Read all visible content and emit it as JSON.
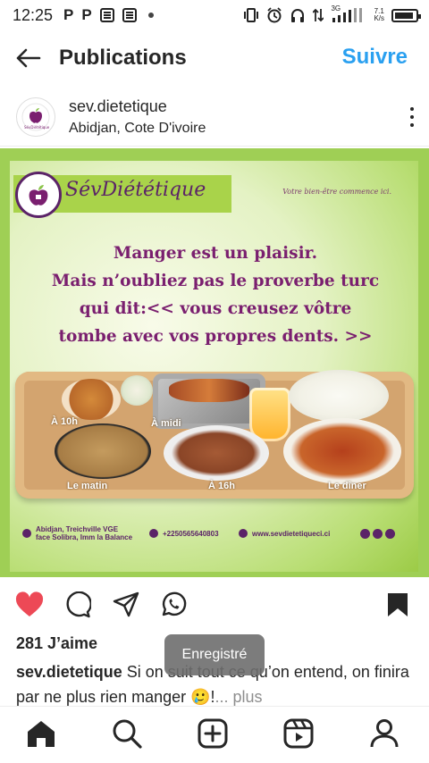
{
  "status_bar": {
    "time": "12:25",
    "left_icons": [
      "P",
      "P"
    ],
    "network_type": "3G",
    "speed_value": "7.1",
    "speed_unit": "K/s"
  },
  "header": {
    "title": "Publications",
    "follow_label": "Suivre"
  },
  "post": {
    "username": "sev.dietetique",
    "location": "Abidjan, Cote D'ivoire",
    "image": {
      "brand": "SévDiététique",
      "tagline": "Votre bien-être commence ici.",
      "message_lines": [
        "Manger est un plaisir.",
        "Mais n’oubliez pas le proverbe turc",
        "qui dit:<< vous creusez vôtre",
        "tombe avec vos propres dents. >>"
      ],
      "meals": {
        "m10h": "À 10h",
        "midi": "À midi",
        "matin": "Le matin",
        "m16h": "À 16h",
        "diner": "Le dîner"
      },
      "address_line1": "Abidjan, Treichville VGE",
      "address_line2": "face Solibra, Imm la Balance",
      "phone": "+2250565640803",
      "website": "www.sevdietetiqueci.ci"
    },
    "likes": "281 J’aime",
    "caption_user": "sev.dietetique",
    "caption_text": " Si on suit tout ce qu’on entend, on finira par ne plus rien manger 🥲!",
    "caption_more": "... plus",
    "liked": true,
    "saved": true
  },
  "toast": "Enregistré",
  "colors": {
    "accent": "#2aa0f0",
    "like": "#ed4956",
    "brand_purple": "#5b2368"
  },
  "icons": [
    "back-arrow-icon",
    "more-vertical-icon",
    "heart-icon",
    "comment-icon",
    "share-icon",
    "whatsapp-icon",
    "bookmark-icon",
    "home-icon",
    "search-icon",
    "add-post-icon",
    "reels-icon",
    "profile-icon"
  ]
}
